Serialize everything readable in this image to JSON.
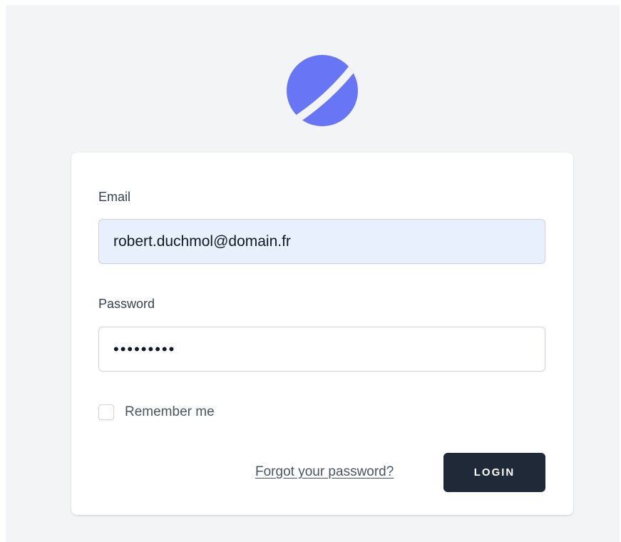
{
  "brand": {
    "logo_icon": "planet-logo-icon",
    "accent_color": "#6875f5"
  },
  "form": {
    "email": {
      "label": "Email",
      "value": "robert.duchmol@domain.fr"
    },
    "password": {
      "label": "Password",
      "value_masked": "•••••••••"
    },
    "remember": {
      "label": "Remember me",
      "checked": false
    },
    "forgot_link": "Forgot your password?",
    "login_label": "LOGIN"
  }
}
